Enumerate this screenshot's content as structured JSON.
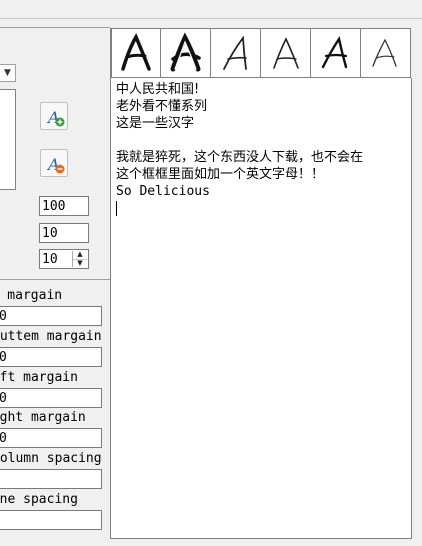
{
  "font_select": {
    "arrow_icon": "chevron-down-icon"
  },
  "font_buttons": [
    {
      "name": "add-font-button",
      "icon": "font-add-icon"
    },
    {
      "name": "remove-font-button",
      "icon": "font-remove-icon"
    }
  ],
  "numeric_fields": [
    {
      "value": "100"
    },
    {
      "value": "10"
    },
    {
      "value": "10"
    }
  ],
  "margins": [
    {
      "label": "Top margain",
      "value": "0"
    },
    {
      "label": "Buttem margain",
      "value": "0"
    },
    {
      "label": "Left margain",
      "value": "0"
    },
    {
      "label": "Right margain",
      "value": "0"
    },
    {
      "label": "Column spacing",
      "value": ""
    },
    {
      "label": "Line spacing",
      "value": ""
    }
  ],
  "glyph_samples": [
    {
      "text": "A",
      "style": "brush-bold"
    },
    {
      "text": "A",
      "style": "brush-outline"
    },
    {
      "text": "A",
      "style": "thin-slanted"
    },
    {
      "text": "A",
      "style": "thin-upright"
    },
    {
      "text": "A",
      "style": "medium"
    },
    {
      "text": "A",
      "style": "thin-light"
    }
  ],
  "editor": {
    "lines": [
      "中人民共和国!",
      "老外看不懂系列",
      "这是一些汉字",
      "",
      "我就是猝死，这个东西没人下载，也不会在",
      "这个框框里面如加一个英文字母！！",
      "So Delicious"
    ]
  }
}
